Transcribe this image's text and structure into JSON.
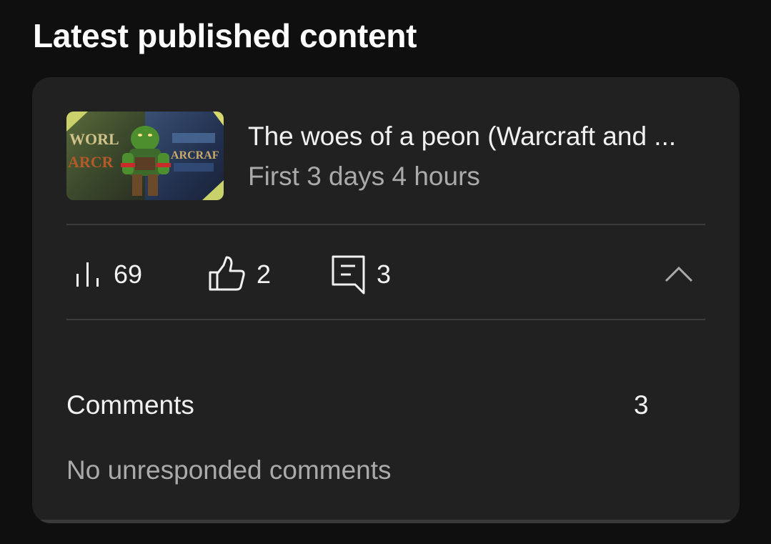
{
  "section": {
    "title": "Latest published content"
  },
  "video": {
    "title": "The woes of a peon (Warcraft and ...",
    "meta": "First 3 days 4 hours",
    "thumbnail_text": {
      "left": "WORLD WARCRAFT",
      "right": "WARCRAFT"
    }
  },
  "stats": {
    "views": {
      "icon": "bar-chart-icon",
      "value": "69"
    },
    "likes": {
      "icon": "thumbs-up-icon",
      "value": "2"
    },
    "comments": {
      "icon": "comment-icon",
      "value": "3"
    }
  },
  "comments_section": {
    "label": "Comments",
    "count": "3",
    "status": "No unresponded comments"
  },
  "colors": {
    "background": "#0f0f0f",
    "card": "#212121",
    "text_primary": "#f1f1f1",
    "text_secondary": "#aaaaaa",
    "divider": "#3d3d3d"
  }
}
